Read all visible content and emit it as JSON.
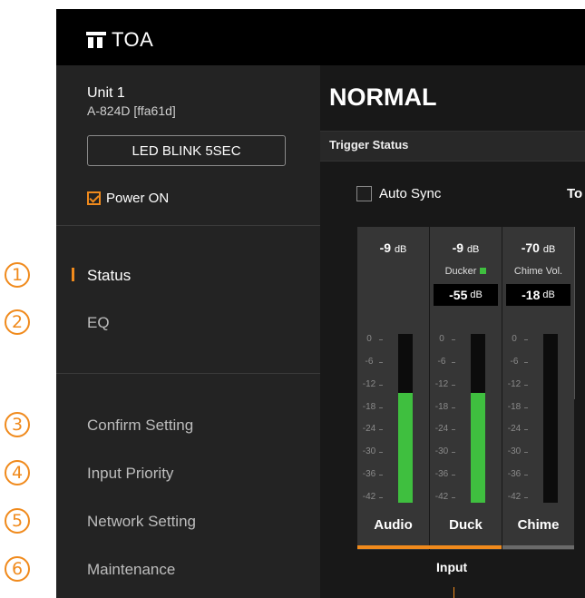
{
  "header": {
    "brand": "TOA"
  },
  "sidebar": {
    "unit_name": "Unit 1",
    "unit_model": "A-824D [ffa61d]",
    "led_button": "LED BLINK 5SEC",
    "power_label": "Power ON",
    "power_checked": true,
    "nav": [
      {
        "label": "Status",
        "active": true
      },
      {
        "label": "EQ"
      },
      {
        "label": "Confirm Setting"
      },
      {
        "label": "Input Priority"
      },
      {
        "label": "Network Setting"
      },
      {
        "label": "Maintenance"
      }
    ],
    "callouts": [
      "1",
      "2",
      "3",
      "4",
      "5",
      "6"
    ]
  },
  "main": {
    "mode": "NORMAL",
    "trigger_status": "Trigger Status",
    "auto_sync": "Auto Sync",
    "to_label": "To",
    "scale": [
      "0",
      "-6",
      "-12",
      "-18",
      "-24",
      "-30",
      "-36",
      "-42"
    ],
    "channels": [
      {
        "level": "-9",
        "unit": "dB",
        "name": "Audio",
        "meter_fill_db": -9
      },
      {
        "level": "-9",
        "unit": "dB",
        "sub": "Ducker",
        "gain": "-55",
        "gain_unit": "dB",
        "name": "Duck",
        "meter_fill_db": -9
      },
      {
        "level": "-70",
        "unit": "dB",
        "sub": "Chime Vol.",
        "gain": "-18",
        "gain_unit": "dB",
        "name": "Chime",
        "meter_fill_db": -70
      }
    ],
    "input_label": "Input"
  },
  "colors": {
    "accent": "#f08a1c",
    "meter": "#3fbf3f",
    "sidebar": "#232323",
    "panel": "#181818"
  }
}
